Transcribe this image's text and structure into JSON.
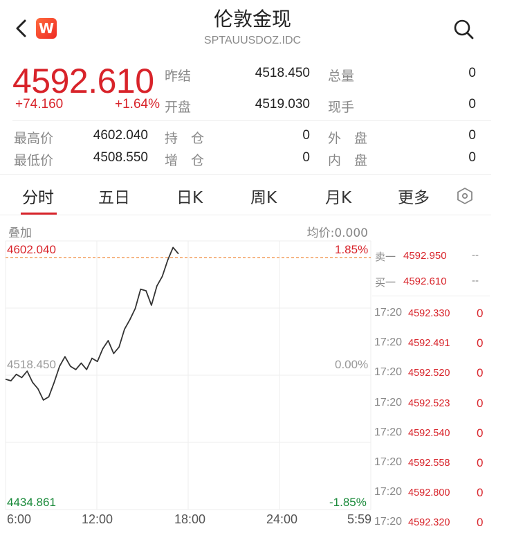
{
  "header": {
    "title": "伦敦金现",
    "subtitle": "SPTAUUSDOZ.IDC",
    "logo_letter": "W"
  },
  "quote": {
    "price": "4592.610",
    "change": "+74.160",
    "change_pct": "+1.64%",
    "fields": [
      {
        "label": "昨结",
        "value": "4518.450"
      },
      {
        "label": "总量",
        "value": "0"
      },
      {
        "label": "开盘",
        "value": "4519.030"
      },
      {
        "label": "现手",
        "value": "0"
      },
      {
        "label": "最高价",
        "value": "4602.040"
      },
      {
        "label": "持　仓",
        "value": "0"
      },
      {
        "label": "外　盘",
        "value": "0"
      },
      {
        "label": "最低价",
        "value": "4508.550"
      },
      {
        "label": "增　仓",
        "value": "0"
      },
      {
        "label": "内　盘",
        "value": "0"
      }
    ]
  },
  "tabs": [
    "分时",
    "五日",
    "日K",
    "周K",
    "月K",
    "更多"
  ],
  "chart": {
    "overlay_label": "叠加",
    "avg_label": "均价:0.000",
    "y_high": "4602.040",
    "y_mid": "4518.450",
    "y_low": "4434.861",
    "pct_high": "1.85%",
    "pct_mid": "0.00%",
    "pct_low": "-1.85%",
    "x_labels": [
      "6:00",
      "12:00",
      "18:00",
      "24:00",
      "5:59"
    ],
    "colors": {
      "up": "#d8232a",
      "down": "#1a8a3a",
      "line": "#333333",
      "ref": "#f08a3c"
    }
  },
  "chart_data": {
    "type": "line",
    "title": "",
    "xlabel": "",
    "ylabel": "",
    "x_ticks": [
      "6:00",
      "12:00",
      "18:00",
      "24:00",
      "5:59"
    ],
    "ylim": [
      4434.861,
      4602.04
    ],
    "reference_price": 4518.45,
    "series": [
      {
        "values": [
          4516,
          4515,
          4519,
          4517,
          4521,
          4514,
          4510,
          4503,
          4505,
          4514,
          4524,
          4530,
          4524,
          4522,
          4526,
          4522,
          4529,
          4527,
          4535,
          4540,
          4532,
          4536,
          4547,
          4553,
          4560,
          4572,
          4571,
          4562,
          4574,
          4580,
          4590,
          4598,
          4594
        ]
      }
    ]
  },
  "order_book": {
    "asks": [
      {
        "label": "卖一",
        "price": "4592.950",
        "vol": "--"
      }
    ],
    "bids": [
      {
        "label": "买一",
        "price": "4592.610",
        "vol": "--"
      }
    ]
  },
  "ticks": [
    {
      "time": "17:20",
      "price": "4592.330",
      "vol": "0"
    },
    {
      "time": "17:20",
      "price": "4592.491",
      "vol": "0"
    },
    {
      "time": "17:20",
      "price": "4592.520",
      "vol": "0"
    },
    {
      "time": "17:20",
      "price": "4592.523",
      "vol": "0"
    },
    {
      "time": "17:20",
      "price": "4592.540",
      "vol": "0"
    },
    {
      "time": "17:20",
      "price": "4592.558",
      "vol": "0"
    },
    {
      "time": "17:20",
      "price": "4592.800",
      "vol": "0"
    },
    {
      "time": "17:20",
      "price": "4592.320",
      "vol": "0"
    }
  ]
}
